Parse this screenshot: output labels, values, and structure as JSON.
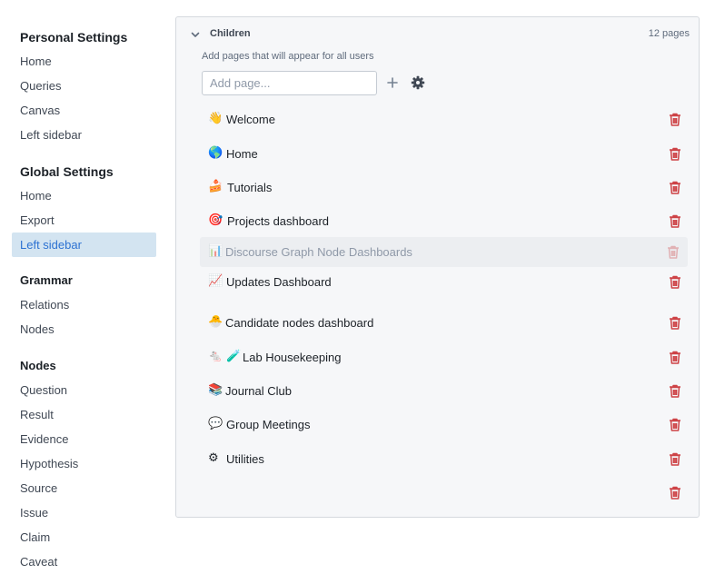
{
  "sidebar": {
    "sections": [
      {
        "title": "Personal Settings",
        "items": [
          "Home",
          "Queries",
          "Canvas",
          "Left sidebar"
        ]
      },
      {
        "title": "Global Settings",
        "items": [
          "Home",
          "Export",
          "Left sidebar"
        ]
      },
      {
        "title": "Grammar",
        "items": [
          "Relations",
          "Nodes"
        ]
      },
      {
        "title": "Nodes",
        "items": [
          "Question",
          "Result",
          "Evidence",
          "Hypothesis",
          "Source",
          "Issue",
          "Claim",
          "Caveat"
        ]
      }
    ],
    "active_item": "Global Settings / Left sidebar"
  },
  "panel": {
    "title": "Children",
    "count": "12 pages",
    "description": "Add pages that will appear for all users",
    "input": {
      "value": "",
      "placeholder": "Add page..."
    },
    "pages": [
      {
        "emoji": "👋",
        "label": "Welcome"
      },
      {
        "emoji": "🌎",
        "label": "Home"
      },
      {
        "emoji": "🍰",
        "label": "Tutorials"
      },
      {
        "emoji": "🎯",
        "label": "Projects dashboard"
      },
      {
        "emoji": "📊",
        "label": "Discourse Graph Node Dashboards",
        "state": "dimmed"
      },
      {
        "emoji": "📈",
        "label": "Updates Dashboard"
      },
      {
        "emoji": "🐣",
        "label": "Candidate nodes dashboard"
      },
      {
        "emoji": "🐁 🧪",
        "label": "Lab Housekeeping"
      },
      {
        "emoji": "📚",
        "label": "Journal Club"
      },
      {
        "emoji": "💬",
        "label": "Group Meetings"
      },
      {
        "emoji": "⚙",
        "label": "Utilities"
      }
    ],
    "icons": {
      "collapse": "chevron-down-icon",
      "add": "plus-icon",
      "settings": "gear-icon",
      "delete": "trash-icon"
    }
  },
  "colors": {
    "active_bg": "#d3e4f1",
    "active_text": "#2d72d2",
    "danger": "#cd4246",
    "panel_bg": "#f6f7f9",
    "border": "#d5d9de"
  }
}
